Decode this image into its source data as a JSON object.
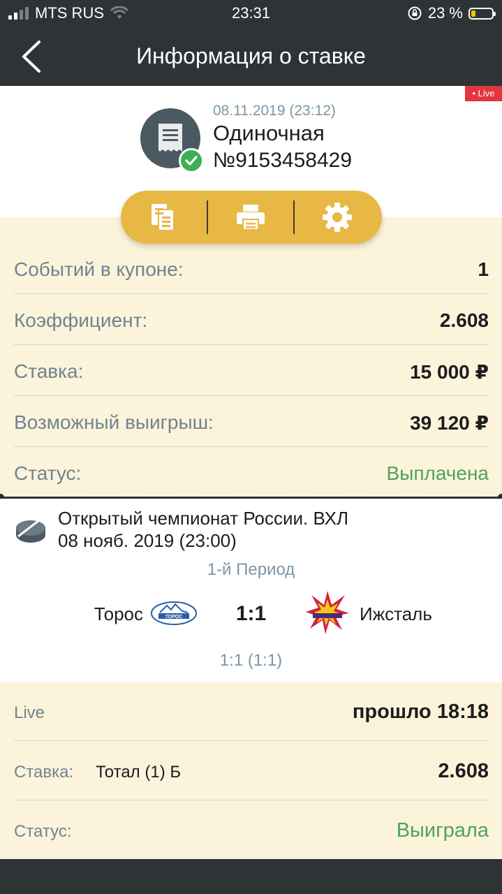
{
  "status_bar": {
    "carrier": "MTS RUS",
    "time": "23:31",
    "battery": "23 %",
    "battery_level": 0.23
  },
  "nav": {
    "title": "Информация о ставке"
  },
  "header": {
    "live_badge": "• Live",
    "date": "08.11.2019 (23:12)",
    "type": "Одиночная",
    "number": "№9153458429"
  },
  "actions": [
    "copy-icon",
    "print-icon",
    "gear-icon"
  ],
  "summary": [
    {
      "label": "Событий в купоне:",
      "value": "1"
    },
    {
      "label": "Коэффициент:",
      "value": "2.608"
    },
    {
      "label": "Ставка:",
      "value": "15 000 ₽"
    },
    {
      "label": "Возможный выигрыш:",
      "value": "39 120 ₽"
    },
    {
      "label": "Статус:",
      "value": "Выплачена"
    }
  ],
  "event": {
    "tournament": "Открытый чемпионат России. ВХЛ",
    "date": "08 нояб. 2019 (23:00)",
    "period": "1-й Период",
    "home_team": "Торос",
    "away_team": "Ижсталь",
    "score": "1:1",
    "sub_score": "1:1 (1:1)"
  },
  "bet": {
    "live_label": "Live",
    "elapsed": "прошло 18:18",
    "stake_label": "Ставка:",
    "stake_market": "Тотал (1) Б",
    "stake_odds": "2.608",
    "status_label": "Статус:",
    "status_value": "Выиграла"
  },
  "colors": {
    "bar": "#2e3336",
    "cream": "#fcf3db",
    "accent": "#e8b844",
    "green": "#4ea35d",
    "live": "#e2363d"
  }
}
